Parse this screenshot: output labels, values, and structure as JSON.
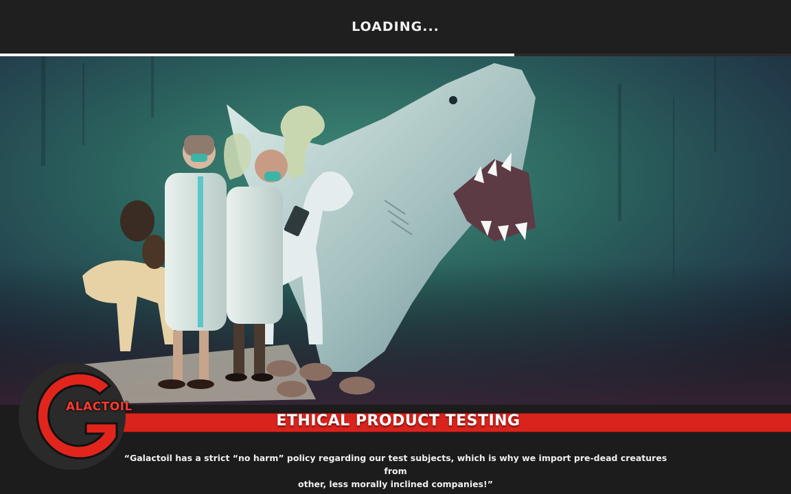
{
  "header": {
    "loading_label": "LOADING..."
  },
  "loading_progress": 0.65,
  "banner": {
    "logo_text": "ALACTOIL",
    "title": "ETHICAL PRODUCT TESTING",
    "quote_line1": "“Galactoil has a strict “no harm” policy regarding our test subjects, which is why we import pre-dead creatures from",
    "quote_line2": "other, less morally inclined companies!”"
  },
  "colors": {
    "accent_red": "#d9231d",
    "background": "#1f1f1f",
    "progress": "#ffffff"
  },
  "icons": [
    "galactoil-logo-icon"
  ]
}
